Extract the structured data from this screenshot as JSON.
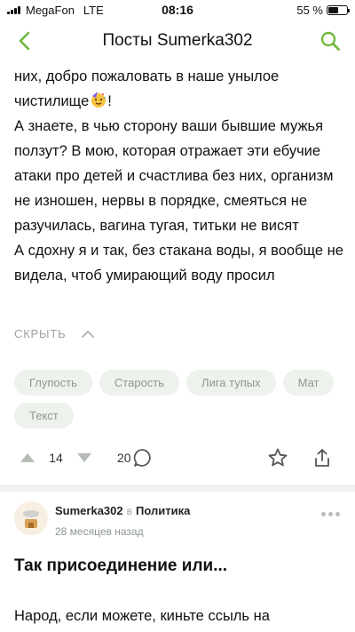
{
  "status_bar": {
    "carrier": "MegaFon",
    "network": "LTE",
    "time": "08:16",
    "battery_percent": "55 %",
    "battery_level": 0.55,
    "signal_icon": "signal-bars-icon",
    "battery_icon": "battery-icon"
  },
  "nav": {
    "title": "Посты Sumerka302",
    "back_icon": "chevron-left-icon",
    "search_icon": "search-icon",
    "accent_color": "#6fb83a"
  },
  "post": {
    "paragraphs": [
      "них, добро пожаловать в наше унылое чистилище",
      "!",
      "А знаете, в чью сторону ваши бывшие мужья ползут? В мою, которая отражает эти ебучие атаки про детей и счастлива без них, организм не изношен, нервы в порядке, смеяться не разучилась, вагина тугая, титьки не висят",
      "А сдохну я и так, без стакана воды, я вообще не видела, чтоб умирающий воду просил"
    ],
    "emoji_icon": "party-face-emoji-icon",
    "collapse_label": "СКРЫТЬ",
    "tags": [
      "Глупость",
      "Старость",
      "Лига тупых",
      "Мат",
      "Текст"
    ],
    "rating": "14",
    "comments_count": "20"
  },
  "next_post": {
    "author": "Sumerka302",
    "in_label": "в",
    "community": "Политика",
    "time": "28 месяцев назад",
    "title": "Так присоединение или...",
    "preview": "Народ, если можете,  киньте ссыль на"
  }
}
